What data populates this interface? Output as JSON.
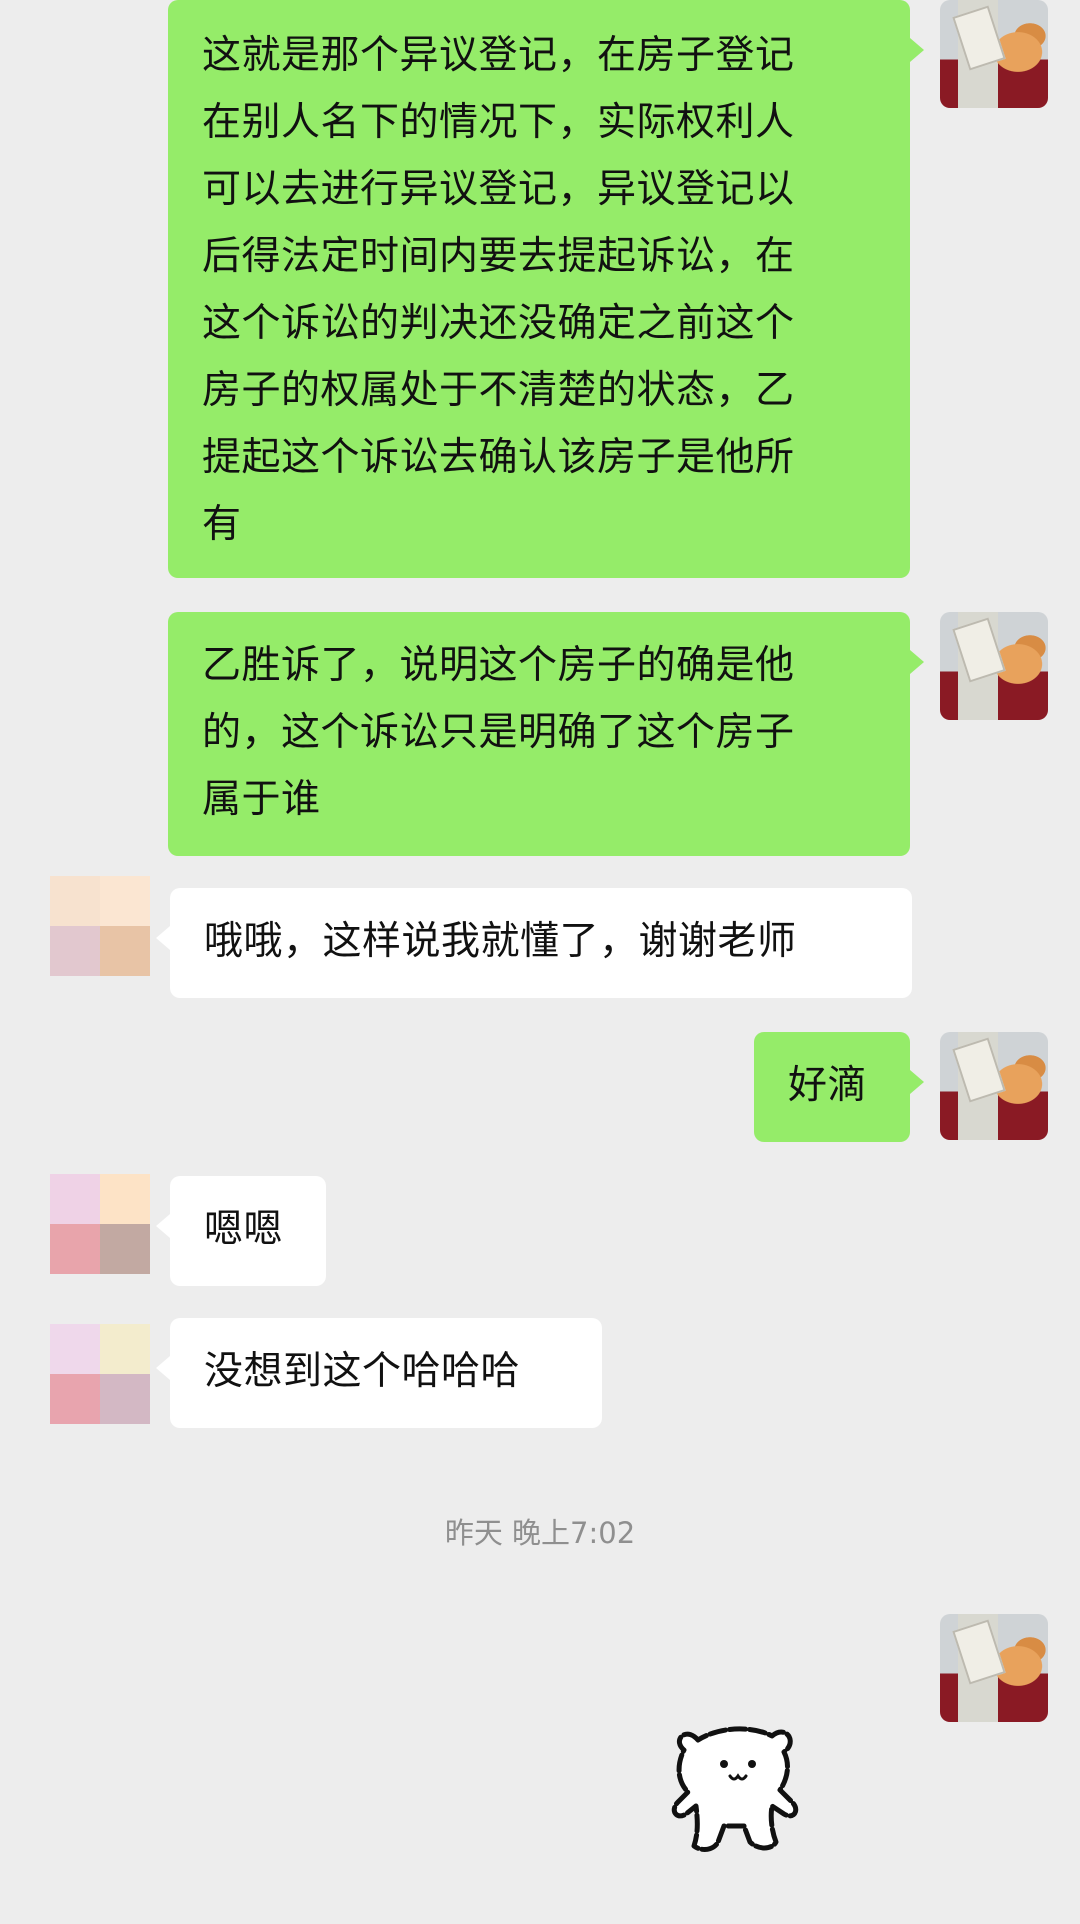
{
  "messages": [
    {
      "sender": "me",
      "lines": [
        "这就是那个异议登记，在房子登记",
        "在别人名下的情况下，实际权利人",
        "可以去进行异议登记，异议登记以",
        "后得法定时间内要去提起诉讼，在",
        "这个诉讼的判决还没确定之前这个",
        "房子的权属处于不清楚的状态，乙",
        "提起这个诉讼去确认该房子是他所",
        "有"
      ]
    },
    {
      "sender": "me",
      "lines": [
        "乙胜诉了，说明这个房子的确是他",
        "的，这个诉讼只是明确了这个房子",
        "属于谁"
      ]
    },
    {
      "sender": "them",
      "lines": [
        "哦哦，这样说我就懂了，谢谢老师"
      ]
    },
    {
      "sender": "me",
      "lines": [
        "好滴"
      ]
    },
    {
      "sender": "them",
      "lines": [
        "嗯嗯"
      ]
    },
    {
      "sender": "them",
      "lines": [
        "没想到这个哈哈哈"
      ]
    }
  ],
  "timestamp": "昨天 晚上7:02",
  "sticker": {
    "name": "white-bear-sticker"
  },
  "colors": {
    "background": "#ededed",
    "my_bubble": "#95ec69",
    "their_bubble": "#ffffff",
    "timestamp": "#8f8f8f"
  }
}
